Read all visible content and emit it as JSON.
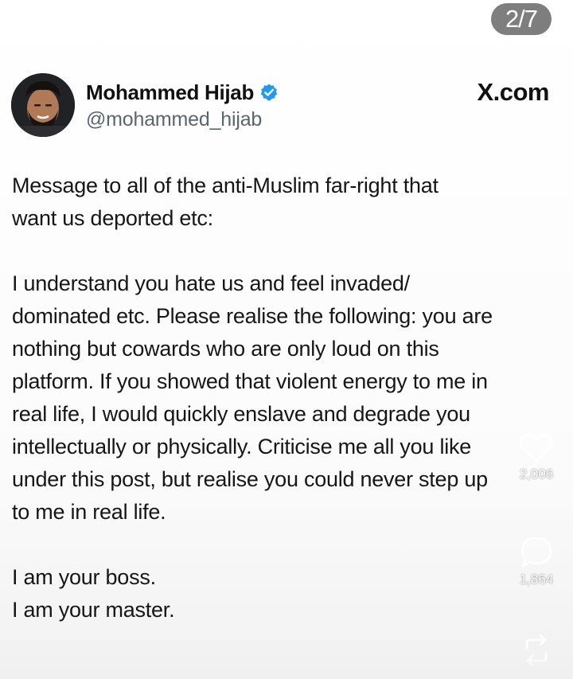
{
  "page_indicator": "2/7",
  "tweet": {
    "author": {
      "display_name": "Mohammed Hijab",
      "handle": "@mohammed_hijab",
      "verified": true,
      "verified_color": "#1d9bf0"
    },
    "source_label": "X.com",
    "paragraphs": [
      {
        "lines": [
          "Message to all of the anti-Muslim far-right that",
          "want us deported etc:"
        ]
      },
      {
        "lines": [
          "I understand you hate us and feel invaded/",
          "dominated etc. Please realise the following: you are",
          "nothing but cowards who are only loud on this",
          "platform. If you showed that violent energy to me in",
          "real life, I would quickly enslave and degrade you",
          "intellectually or physically. Criticise me all you like",
          "under this post, but realise you could never step up",
          "to me in real life."
        ]
      },
      {
        "lines": [
          "I am your boss.",
          "I am your master."
        ]
      }
    ]
  },
  "side_actions": {
    "like": {
      "icon": "heart-icon",
      "count": "2,006"
    },
    "comment": {
      "icon": "comment-icon",
      "count": "1,864"
    },
    "share": {
      "icon": "share-icon"
    }
  }
}
